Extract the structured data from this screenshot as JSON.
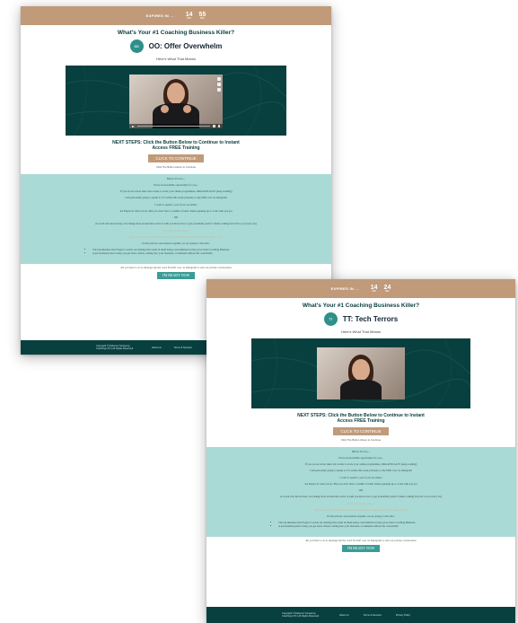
{
  "pages": [
    {
      "timer": {
        "label": "EXPIRES IN ...",
        "units": [
          {
            "value": "14",
            "label": "MIN"
          },
          {
            "value": "55",
            "label": "SEC"
          }
        ]
      },
      "question": "What's Your #1 Coaching Business Killer?",
      "badge": "OO",
      "killer_title": "OO: Offer Overwhelm",
      "means": "Here's What That Means",
      "next_steps": "NEXT STEPS: Click the Button Below to Continue to Instant Access FREE Training",
      "cta": "CLICK TO CONTINUE",
      "cta_note": "Click The Button Above to Continue",
      "body": [
        "Before You Go...",
        "I have an incredible opportunity for you...",
        "If you are an action taker who wants to scale your online programmes, ORGANICALLY (keep reading)",
        "I am personally going to speak to 9 Coaches this week privately to my DMs over on Instagram",
        "I want to speak to you if you are either:",
        "An Expert in what you do. But you don't have a waitlist of ideal clients queuing up to work with you yet",
        "OR",
        "A Coach who knows they can change lives around the world. A with you know how to get potentially perfect clients coming forward to you every day"
      ],
      "gold_lines": [
        "If you are in this place...",
        "Sign up and I will personally review your application and decide if this is right for you"
      ],
      "private_intro": "In this private conversation together, we are going to dive into:",
      "bullets": [
        "The big mistakes that Expert Coaches are making that result in them being overwhelmed as they grow their Coaching Business",
        "A personalised plan to help you get more clients coming into your business, on demand without the overwhelm"
      ],
      "closing": "All you have to do is message me the word SCALE over on Instagram to start our private conversation",
      "message_button": "I'M READY NOW",
      "footer": {
        "copyright": "Copyright © Rebecca Turnpenny Coaching LTD | All Rights Reserved",
        "links": [
          "About Us",
          "Terms & Services"
        ]
      }
    },
    {
      "timer": {
        "label": "EXPIRES IN ...",
        "units": [
          {
            "value": "14",
            "label": "MIN"
          },
          {
            "value": "24",
            "label": "SEC"
          }
        ]
      },
      "question": "What's Your #1 Coaching Business Killer?",
      "badge": "TT",
      "killer_title": "TT: Tech Terrors",
      "means": "Here's What That Means",
      "next_steps": "NEXT STEPS: Click the Button Below to Continue to Instant Access FREE Training",
      "cta": "CLICK TO CONTINUE",
      "cta_note": "Click The Button Above to Continue",
      "body": [
        "Before You Go...",
        "I have an incredible opportunity for you...",
        "If you are an action taker who wants to scale your online programmes, ORGANICALLY (keep reading)",
        "I am personally going to speak to 9 Coaches this week privately to my DMs over on Instagram",
        "I want to speak to you if you are either:",
        "An Expert in what you do. But you don't have a waitlist of ideal clients queuing up to work with you yet",
        "OR",
        "A Coach who knows they can change lives around the world. A with you know how to get potentially perfect clients coming forward to you every day"
      ],
      "gold_lines": [
        "If you are in this place...",
        "Sign up and I will personally review your application and decide if this is right for you"
      ],
      "private_intro": "In this private conversation together, we are going to dive into:",
      "bullets": [
        "The big mistakes that Expert Coaches are making that result in them being overwhelmed as they grow their Coaching Business",
        "A personalised plan to help you get more clients coming into your business, on demand without the overwhelm"
      ],
      "closing": "All you have to do is message me the word SCALE over on Instagram to start our private conversation",
      "message_button": "I'M READY NOW",
      "footer": {
        "copyright": "Copyright © Rebecca Turnpenny Coaching LTD | All Rights Reserved",
        "links": [
          "About Us",
          "Terms & Services",
          "Privacy Policy"
        ]
      }
    }
  ]
}
